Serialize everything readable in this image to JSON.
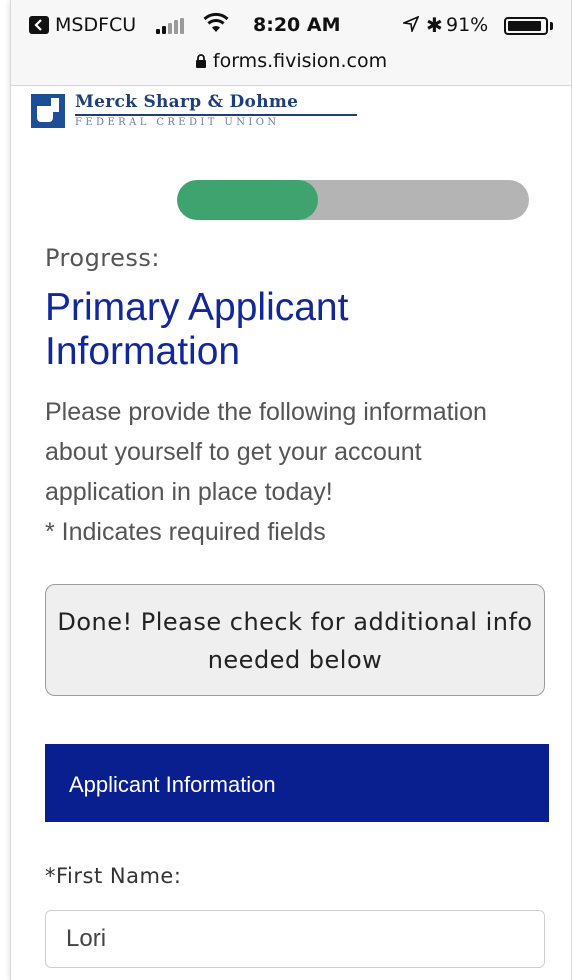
{
  "status_bar": {
    "carrier": "MSDFCU",
    "time": "8:20 AM",
    "battery_percent": "91%",
    "battery_level": 0.91,
    "icons": [
      "back-to-app-icon",
      "signal-icon",
      "wifi-icon",
      "location-icon",
      "bluetooth-icon",
      "battery-icon"
    ]
  },
  "browser": {
    "url": "forms.fivision.com",
    "url_icon": "lock-icon"
  },
  "logo": {
    "title": "Merck Sharp & Dohme",
    "subtitle": "FEDERAL CREDIT UNION"
  },
  "progress": {
    "value_fraction": 0.4,
    "label": "Progress:",
    "fill_color": "#3ea36e",
    "track_color": "#b4b4b4"
  },
  "page": {
    "title": "Primary Applicant Information",
    "intro": "Please provide the following information about yourself to get your account application in place today!",
    "required_note": "* Indicates required fields",
    "title_color": "#11279b"
  },
  "notice": {
    "text": "Done! Please check for additional info needed below"
  },
  "section": {
    "heading": "Applicant Information",
    "color": "#0a1f8f"
  },
  "form": {
    "first_name_label": "*First Name:",
    "first_name_value": "Lori"
  }
}
